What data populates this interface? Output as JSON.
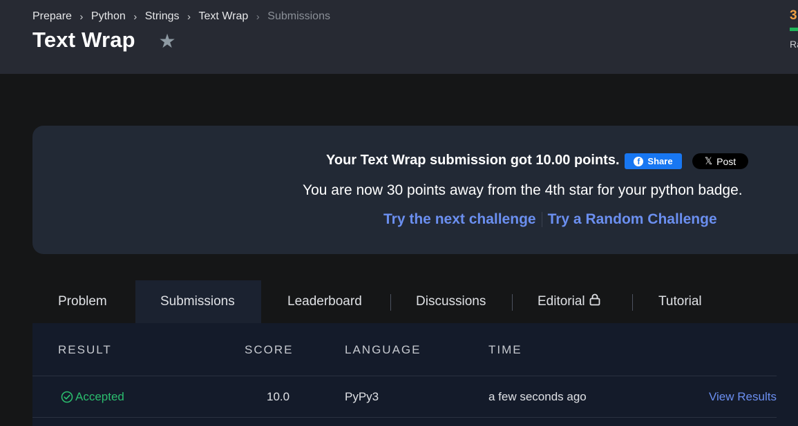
{
  "breadcrumb": {
    "items": [
      "Prepare",
      "Python",
      "Strings",
      "Text Wrap",
      "Submissions"
    ]
  },
  "page_title": "Text Wrap",
  "rank": {
    "top": "3",
    "label": "Ra"
  },
  "congrats": {
    "line1": "Your Text Wrap submission got 10.00 points.",
    "share_label": "Share",
    "post_label": "Post",
    "line2": "You are now 30 points away from the 4th star for your python badge.",
    "next_challenge": "Try the next challenge",
    "random_challenge": "Try a Random Challenge"
  },
  "tabs": [
    "Problem",
    "Submissions",
    "Leaderboard",
    "Discussions",
    "Editorial",
    "Tutorial"
  ],
  "table": {
    "headers": [
      "RESULT",
      "SCORE",
      "LANGUAGE",
      "TIME"
    ],
    "row": {
      "result": "Accepted",
      "score": "10.0",
      "language": "PyPy3",
      "time": "a few seconds ago",
      "action": "View Results"
    }
  },
  "colors": {
    "accent_blue": "#6b8ff0",
    "success_green": "#2bbd6e",
    "facebook_blue": "#1877f2"
  },
  "icons": [
    "star-icon",
    "chevron-right-icon",
    "facebook-icon",
    "x-icon",
    "lock-icon",
    "check-circle-icon"
  ]
}
